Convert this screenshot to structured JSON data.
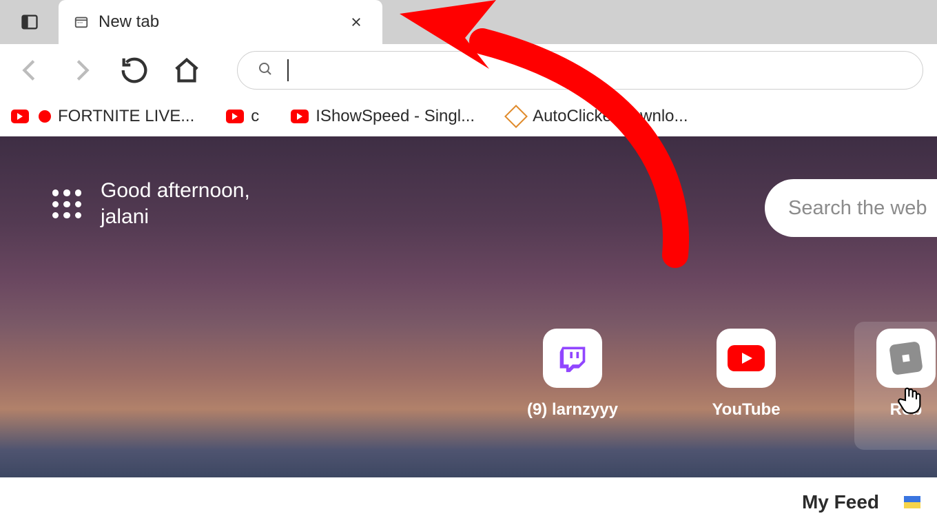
{
  "tab": {
    "title": "New tab"
  },
  "address": {
    "value": ""
  },
  "bookmarks": [
    {
      "label": "FORTNITE LIVE...",
      "icon": "youtube",
      "live": true
    },
    {
      "label": "c",
      "icon": "youtube",
      "live": false
    },
    {
      "label": "IShowSpeed - Singl...",
      "icon": "youtube",
      "live": false
    },
    {
      "label": "AutoClicker downlo...",
      "icon": "autoclicker",
      "live": false
    }
  ],
  "greeting": {
    "line1": "Good afternoon,",
    "line2": "jalani"
  },
  "search_web": {
    "placeholder": "Search the web"
  },
  "tiles": [
    {
      "label": "(9) larnzyyy",
      "icon": "twitch"
    },
    {
      "label": "YouTube",
      "icon": "youtube"
    },
    {
      "label": "Rob",
      "icon": "roblox"
    }
  ],
  "feed": {
    "label": "My Feed"
  }
}
